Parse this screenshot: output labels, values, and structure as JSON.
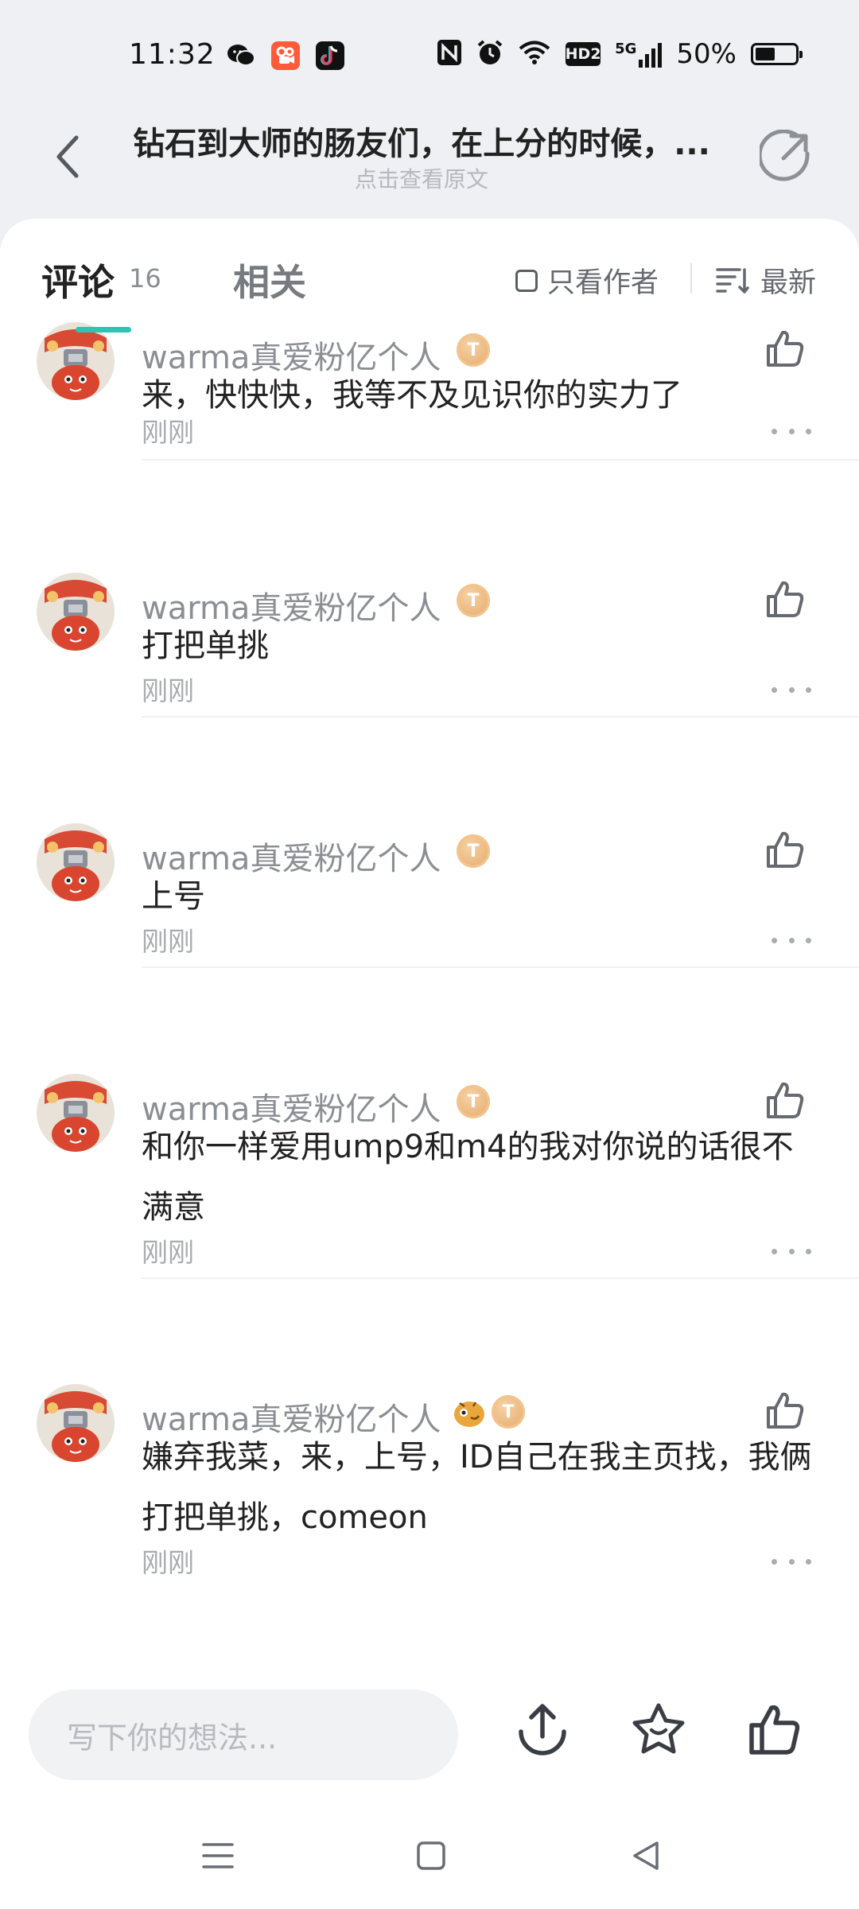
{
  "status_bar": {
    "time": "11:32",
    "apps": [
      "wechat-icon",
      "kuaishou-icon",
      "douyin-icon"
    ],
    "icons": [
      "nfc-icon",
      "alarm-icon",
      "wifi-icon",
      "hd-icon",
      "signal-5g-icon"
    ],
    "hd_label": "HD2",
    "network_label": "5G",
    "battery_text": "50%",
    "battery_level": 0.5
  },
  "header": {
    "title": "钻石到大师的肠友们，在上分的时候，...",
    "subtitle": "点击查看原文"
  },
  "tabs": {
    "comments_label": "评论",
    "comments_count": "16",
    "related_label": "相关",
    "author_only_label": "只看作者",
    "sort_label": "最新"
  },
  "comments": [
    {
      "username": "warma真爱粉亿个人",
      "text": "来，快快快，我等不及见识你的实力了",
      "time": "刚刚",
      "badges": [
        "tier-badge"
      ]
    },
    {
      "username": "warma真爱粉亿个人",
      "text": "打把单挑",
      "time": "刚刚",
      "badges": [
        "tier-badge"
      ]
    },
    {
      "username": "warma真爱粉亿个人",
      "text": "上号",
      "time": "刚刚",
      "badges": [
        "tier-badge"
      ]
    },
    {
      "username": "warma真爱粉亿个人",
      "text": "和你一样爱用ump9和m4的我对你说的话很不满意",
      "time": "刚刚",
      "badges": [
        "tier-badge"
      ]
    },
    {
      "username": "warma真爱粉亿个人",
      "text": "嫌弃我菜，来，上号，ID自己在我主页找，我俩打把单挑，comeon",
      "time": "刚刚",
      "badges": [
        "emoji-badge",
        "tier-badge"
      ]
    }
  ],
  "badge_letter": "T",
  "bottom_bar": {
    "input_placeholder": "写下你的想法..."
  },
  "colors": {
    "accent": "#2bc5b2",
    "page_bg": "#eef0f3",
    "badge": "#e9b27a"
  }
}
